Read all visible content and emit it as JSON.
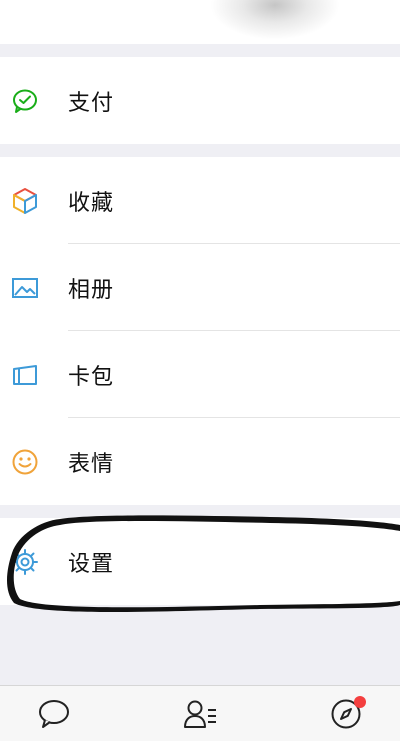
{
  "menu": {
    "pay": {
      "label": "支付",
      "icon": "wechat-pay-icon"
    },
    "favorites": {
      "label": "收藏",
      "icon": "cube-icon"
    },
    "album": {
      "label": "相册",
      "icon": "picture-icon"
    },
    "cards": {
      "label": "卡包",
      "icon": "card-wallet-icon"
    },
    "stickers": {
      "label": "表情",
      "icon": "smiley-icon"
    },
    "settings": {
      "label": "设置",
      "icon": "gear-icon"
    }
  },
  "tabbar": {
    "chats_icon": "chat-bubble-icon",
    "contacts_icon": "contacts-icon",
    "discover_icon": "compass-icon"
  },
  "colors": {
    "pay_green": "#1aad19",
    "icon_blue": "#3d9ad8",
    "stickers_orange": "#f0a33a",
    "badge_red": "#f43f3f",
    "annotation_ink": "#111111"
  }
}
